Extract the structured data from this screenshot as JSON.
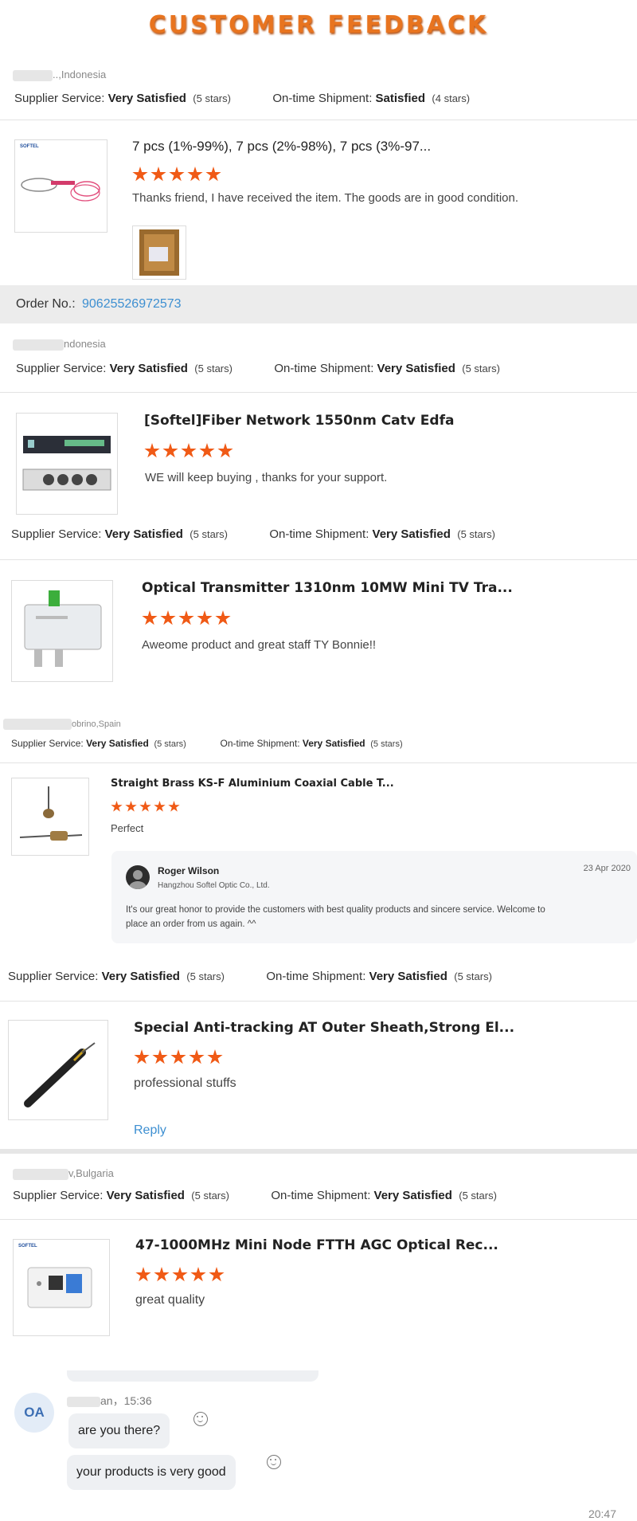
{
  "header": {
    "title": "CUSTOMER  FEEDBACK"
  },
  "colors": {
    "accent": "#e8741f",
    "star": "#f05a16",
    "link": "#3d8fd1"
  },
  "labels": {
    "supplier_service": "Supplier Service:",
    "ontime_shipment": "On-time Shipment:",
    "order_no": "Order No.:",
    "reply": "Reply"
  },
  "reviews": [
    {
      "buyer": "..,Indonesia",
      "supplier_rating": "Very Satisfied",
      "supplier_stars": "(5 stars)",
      "shipment_rating": "Satisfied",
      "shipment_stars": "(4 stars)",
      "product": "7 pcs (1%-99%), 7 pcs (2%-98%), 7 pcs (3%-97...",
      "thumb_brand": "SOFTEL",
      "comment": "Thanks friend, I have received the item.  The goods are in good condition.",
      "order_no": "90625526972573"
    },
    {
      "buyer": "ndonesia",
      "supplier_rating": "Very Satisfied",
      "supplier_stars": "(5 stars)",
      "shipment_rating": "Very Satisfied",
      "shipment_stars": "(5 stars)",
      "product": "[Softel]Fiber Network 1550nm Catv Edfa",
      "comment": "WE will keep buying , thanks for your support."
    },
    {
      "supplier_rating": "Very Satisfied",
      "supplier_stars": "(5 stars)",
      "shipment_rating": "Very Satisfied",
      "shipment_stars": "(5 stars)",
      "product": "Optical Transmitter 1310nm 10MW Mini TV Tra...",
      "comment": "Aweome product and great staff TY Bonnie!!"
    },
    {
      "buyer": "obrino,Spain",
      "supplier_rating": "Very Satisfied",
      "supplier_stars": "(5 stars)",
      "shipment_rating": "Very Satisfied",
      "shipment_stars": "(5 stars)",
      "product": "Straight Brass KS-F Aluminium Coaxial Cable T...",
      "comment": "Perfect",
      "seller_reply": {
        "name": "Roger Wilson",
        "company": "Hangzhou Softel Optic Co., Ltd.",
        "date": "23 Apr 2020",
        "text_line1": "It's our great honor to provide the customers with best quality products and sincere service. Welcome to",
        "text_line2": "place an order from us again. ^^"
      }
    },
    {
      "supplier_rating": "Very Satisfied",
      "supplier_stars": "(5 stars)",
      "shipment_rating": "Very Satisfied",
      "shipment_stars": "(5 stars)",
      "product": "Special Anti-tracking AT Outer Sheath,Strong El...",
      "comment": "professional stuffs"
    },
    {
      "buyer": "v,Bulgaria",
      "supplier_rating": "Very Satisfied",
      "supplier_stars": "(5 stars)",
      "shipment_rating": "Very Satisfied",
      "shipment_stars": "(5 stars)",
      "product": "47-1000MHz Mini Node FTTH AGC Optical Rec...",
      "thumb_brand": "SOFTEL",
      "comment": "great quality"
    }
  ],
  "chat": {
    "avatar_initials": "OA",
    "sender_time": "an，15:36",
    "messages": [
      "are you there?",
      "your products is very good"
    ],
    "timestamp": "20:47"
  }
}
